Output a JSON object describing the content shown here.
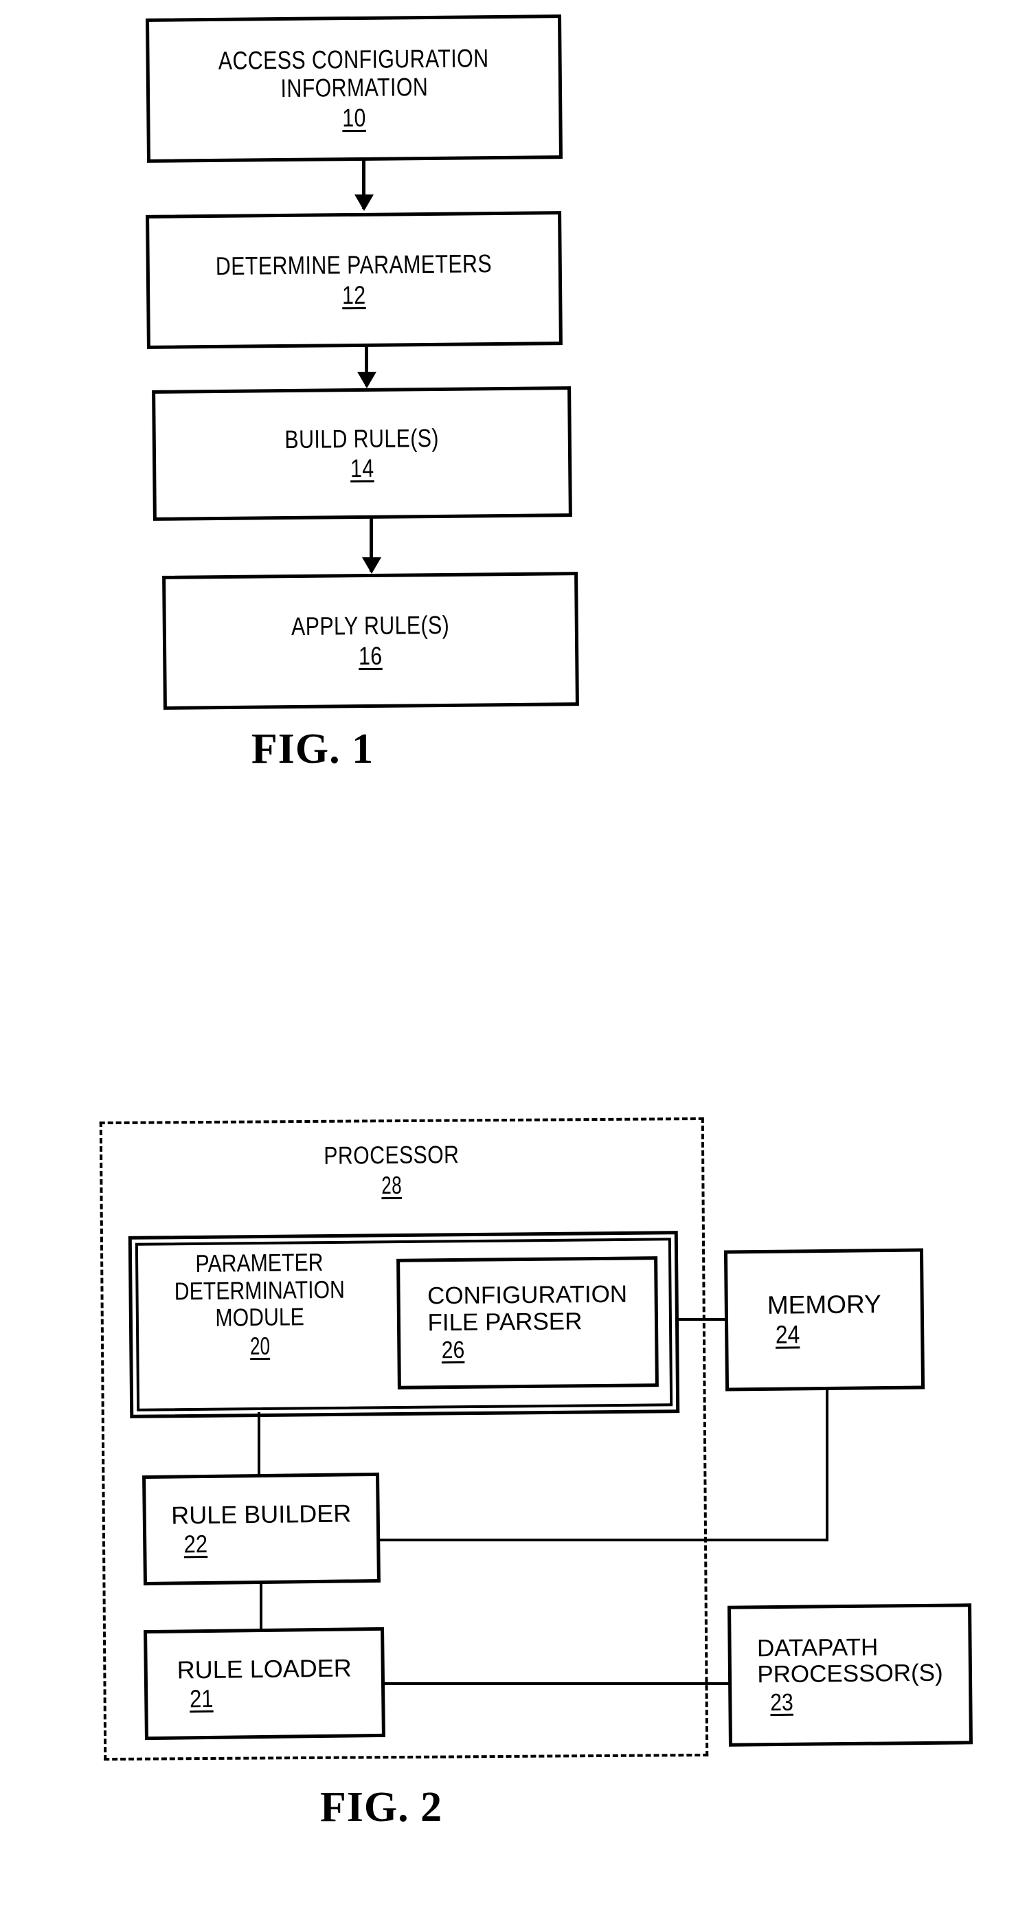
{
  "figures": [
    {
      "caption": "FIG. 1",
      "type": "flowchart",
      "steps": [
        {
          "label": "ACCESS CONFIGURATION",
          "label2": "INFORMATION",
          "ref": "10"
        },
        {
          "label": "DETERMINE PARAMETERS",
          "label2": "",
          "ref": "12"
        },
        {
          "label": "BUILD RULE(S)",
          "label2": "",
          "ref": "14"
        },
        {
          "label": "APPLY RULE(S)",
          "label2": "",
          "ref": "16"
        }
      ]
    },
    {
      "caption": "FIG. 2",
      "type": "block-diagram",
      "boundary": {
        "label": "PROCESSOR",
        "ref": "28",
        "style": "dashed"
      },
      "blocks": [
        {
          "label_line1": "PARAMETER",
          "label_line2": "DETERMINATION",
          "label_line3": "MODULE",
          "ref": "20"
        },
        {
          "label_line1": "CONFIGURATION",
          "label_line2": "FILE PARSER",
          "label_line3": "",
          "ref": "26"
        },
        {
          "label_line1": "MEMORY",
          "label_line2": "",
          "label_line3": "",
          "ref": "24"
        },
        {
          "label_line1": "RULE BUILDER",
          "label_line2": "",
          "label_line3": "",
          "ref": "22"
        },
        {
          "label_line1": "RULE LOADER",
          "label_line2": "",
          "label_line3": "",
          "ref": "21"
        },
        {
          "label_line1": "DATAPATH",
          "label_line2": "PROCESSOR(S)",
          "label_line3": "",
          "ref": "23"
        }
      ]
    }
  ],
  "colors": {
    "ink": "#000000",
    "paper": "#ffffff"
  }
}
